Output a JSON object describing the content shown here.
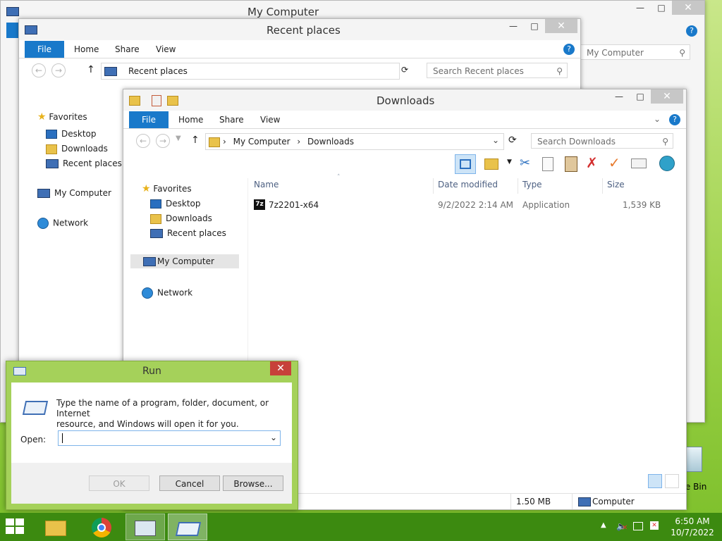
{
  "my_computer_window": {
    "title": "My Computer",
    "search_placeholder": "My Computer"
  },
  "recent_window": {
    "title": "Recent places",
    "ribbon_tabs": [
      "File",
      "Home",
      "Share",
      "View"
    ],
    "address": "Recent places",
    "search_placeholder": "Search Recent places",
    "nav": {
      "favorites": "Favorites",
      "desktop": "Desktop",
      "downloads": "Downloads",
      "recent": "Recent places",
      "my_computer": "My Computer",
      "network": "Network"
    }
  },
  "downloads_window": {
    "title": "Downloads",
    "ribbon_tabs": [
      "File",
      "Home",
      "Share",
      "View"
    ],
    "breadcrumb": [
      "My Computer",
      "Downloads"
    ],
    "search_placeholder": "Search Downloads",
    "nav": {
      "favorites": "Favorites",
      "desktop": "Desktop",
      "downloads": "Downloads",
      "recent": "Recent places",
      "my_computer": "My Computer",
      "network": "Network"
    },
    "columns": [
      "Name",
      "Date modified",
      "Type",
      "Size"
    ],
    "files": [
      {
        "name": "7z2201-x64",
        "date": "9/2/2022 2:14 AM",
        "type": "Application",
        "size": "1,539 KB",
        "icon": "7zip-icon"
      }
    ],
    "status_size": "1.50 MB",
    "status_location": "Computer"
  },
  "run_dialog": {
    "title": "Run",
    "description_line1": "Type the name of a program, folder, document, or Internet",
    "description_line2": "resource, and Windows will open it for you.",
    "open_label": "Open:",
    "open_value": "",
    "ok": "OK",
    "cancel": "Cancel",
    "browse": "Browse..."
  },
  "desktop": {
    "recycle_bin_partial": "cle Bin"
  },
  "taskbar": {
    "time": "6:50 AM",
    "date": "10/7/2022",
    "apps": [
      "file-explorer-icon",
      "chrome-icon",
      "performance-monitor-icon",
      "run-icon"
    ]
  },
  "colors": {
    "accent": "#1979ca",
    "taskbar": "#3c8a10",
    "run_frame": "#a5d15a",
    "close_red": "#c7413a"
  }
}
